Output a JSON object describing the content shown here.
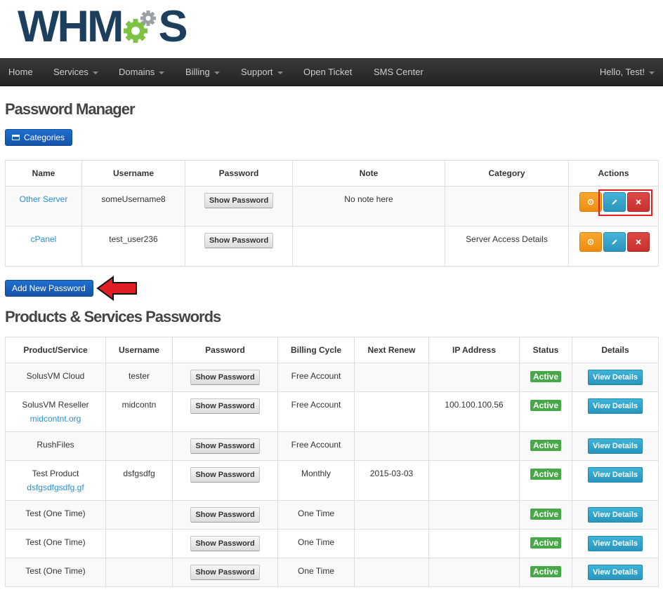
{
  "logo": {
    "text_left": "WHM",
    "text_right": "S"
  },
  "nav": {
    "items": [
      {
        "label": "Home",
        "dropdown": false
      },
      {
        "label": "Services",
        "dropdown": true
      },
      {
        "label": "Domains",
        "dropdown": true
      },
      {
        "label": "Billing",
        "dropdown": true
      },
      {
        "label": "Support",
        "dropdown": true
      },
      {
        "label": "Open Ticket",
        "dropdown": false
      },
      {
        "label": "SMS Center",
        "dropdown": false
      }
    ],
    "user": "Hello, Test!"
  },
  "password_manager": {
    "title": "Password Manager",
    "categories_button": "Categories",
    "columns": [
      "Name",
      "Username",
      "Password",
      "Note",
      "Category",
      "Actions"
    ],
    "rows": [
      {
        "name": "Other Server",
        "username": "someUsername8",
        "password_button": "Show Password",
        "note": "No note here",
        "category": ""
      },
      {
        "name": "cPanel",
        "username": "test_user236",
        "password_button": "Show Password",
        "note": "",
        "category": "Server Access Details"
      }
    ],
    "add_button": "Add New Password"
  },
  "products": {
    "title": "Products & Services Passwords",
    "columns": [
      "Product/Service",
      "Username",
      "Password",
      "Billing Cycle",
      "Next Renew",
      "IP Address",
      "Status",
      "Details"
    ],
    "rows": [
      {
        "product": "SolusVM Cloud",
        "domain": "",
        "username": "tester",
        "password_button": "Show Password",
        "billing_cycle": "Free Account",
        "next_renew": "",
        "ip": "",
        "status": "Active",
        "details_button": "View Details"
      },
      {
        "product": "SolusVM Reseller",
        "domain": "midcontnt.org",
        "username": "midcontn",
        "password_button": "Show Password",
        "billing_cycle": "Free Account",
        "next_renew": "",
        "ip": "100.100.100.56",
        "status": "Active",
        "details_button": "View Details"
      },
      {
        "product": "RushFiles",
        "domain": "",
        "username": "",
        "password_button": "Show Password",
        "billing_cycle": "Free Account",
        "next_renew": "",
        "ip": "",
        "status": "Active",
        "details_button": "View Details"
      },
      {
        "product": "Test Product",
        "domain": "dsfgsdfgsdfg.gf",
        "username": "dsfgsdfg",
        "password_button": "Show Password",
        "billing_cycle": "Monthly",
        "next_renew": "2015-03-03",
        "ip": "",
        "status": "Active",
        "details_button": "View Details"
      },
      {
        "product": "Test (One Time)",
        "domain": "",
        "username": "",
        "password_button": "Show Password",
        "billing_cycle": "One Time",
        "next_renew": "",
        "ip": "",
        "status": "Active",
        "details_button": "View Details"
      },
      {
        "product": "Test (One Time)",
        "domain": "",
        "username": "",
        "password_button": "Show Password",
        "billing_cycle": "One Time",
        "next_renew": "",
        "ip": "",
        "status": "Active",
        "details_button": "View Details"
      },
      {
        "product": "Test (One Time)",
        "domain": "",
        "username": "",
        "password_button": "Show Password",
        "billing_cycle": "One Time",
        "next_renew": "",
        "ip": "",
        "status": "Active",
        "details_button": "View Details"
      }
    ]
  },
  "colors": {
    "navbar": "#222222",
    "primary": "#1a62bf",
    "warning": "#f0950f",
    "info": "#2a94bd",
    "danger": "#c9302c",
    "success": "#46a846",
    "highlight": "#e01e25"
  },
  "icons": {
    "categories": "credit-card-icon",
    "view": "eye-icon",
    "edit": "pencil-icon",
    "delete": "close-icon",
    "annotation": "red-arrow-icon"
  }
}
